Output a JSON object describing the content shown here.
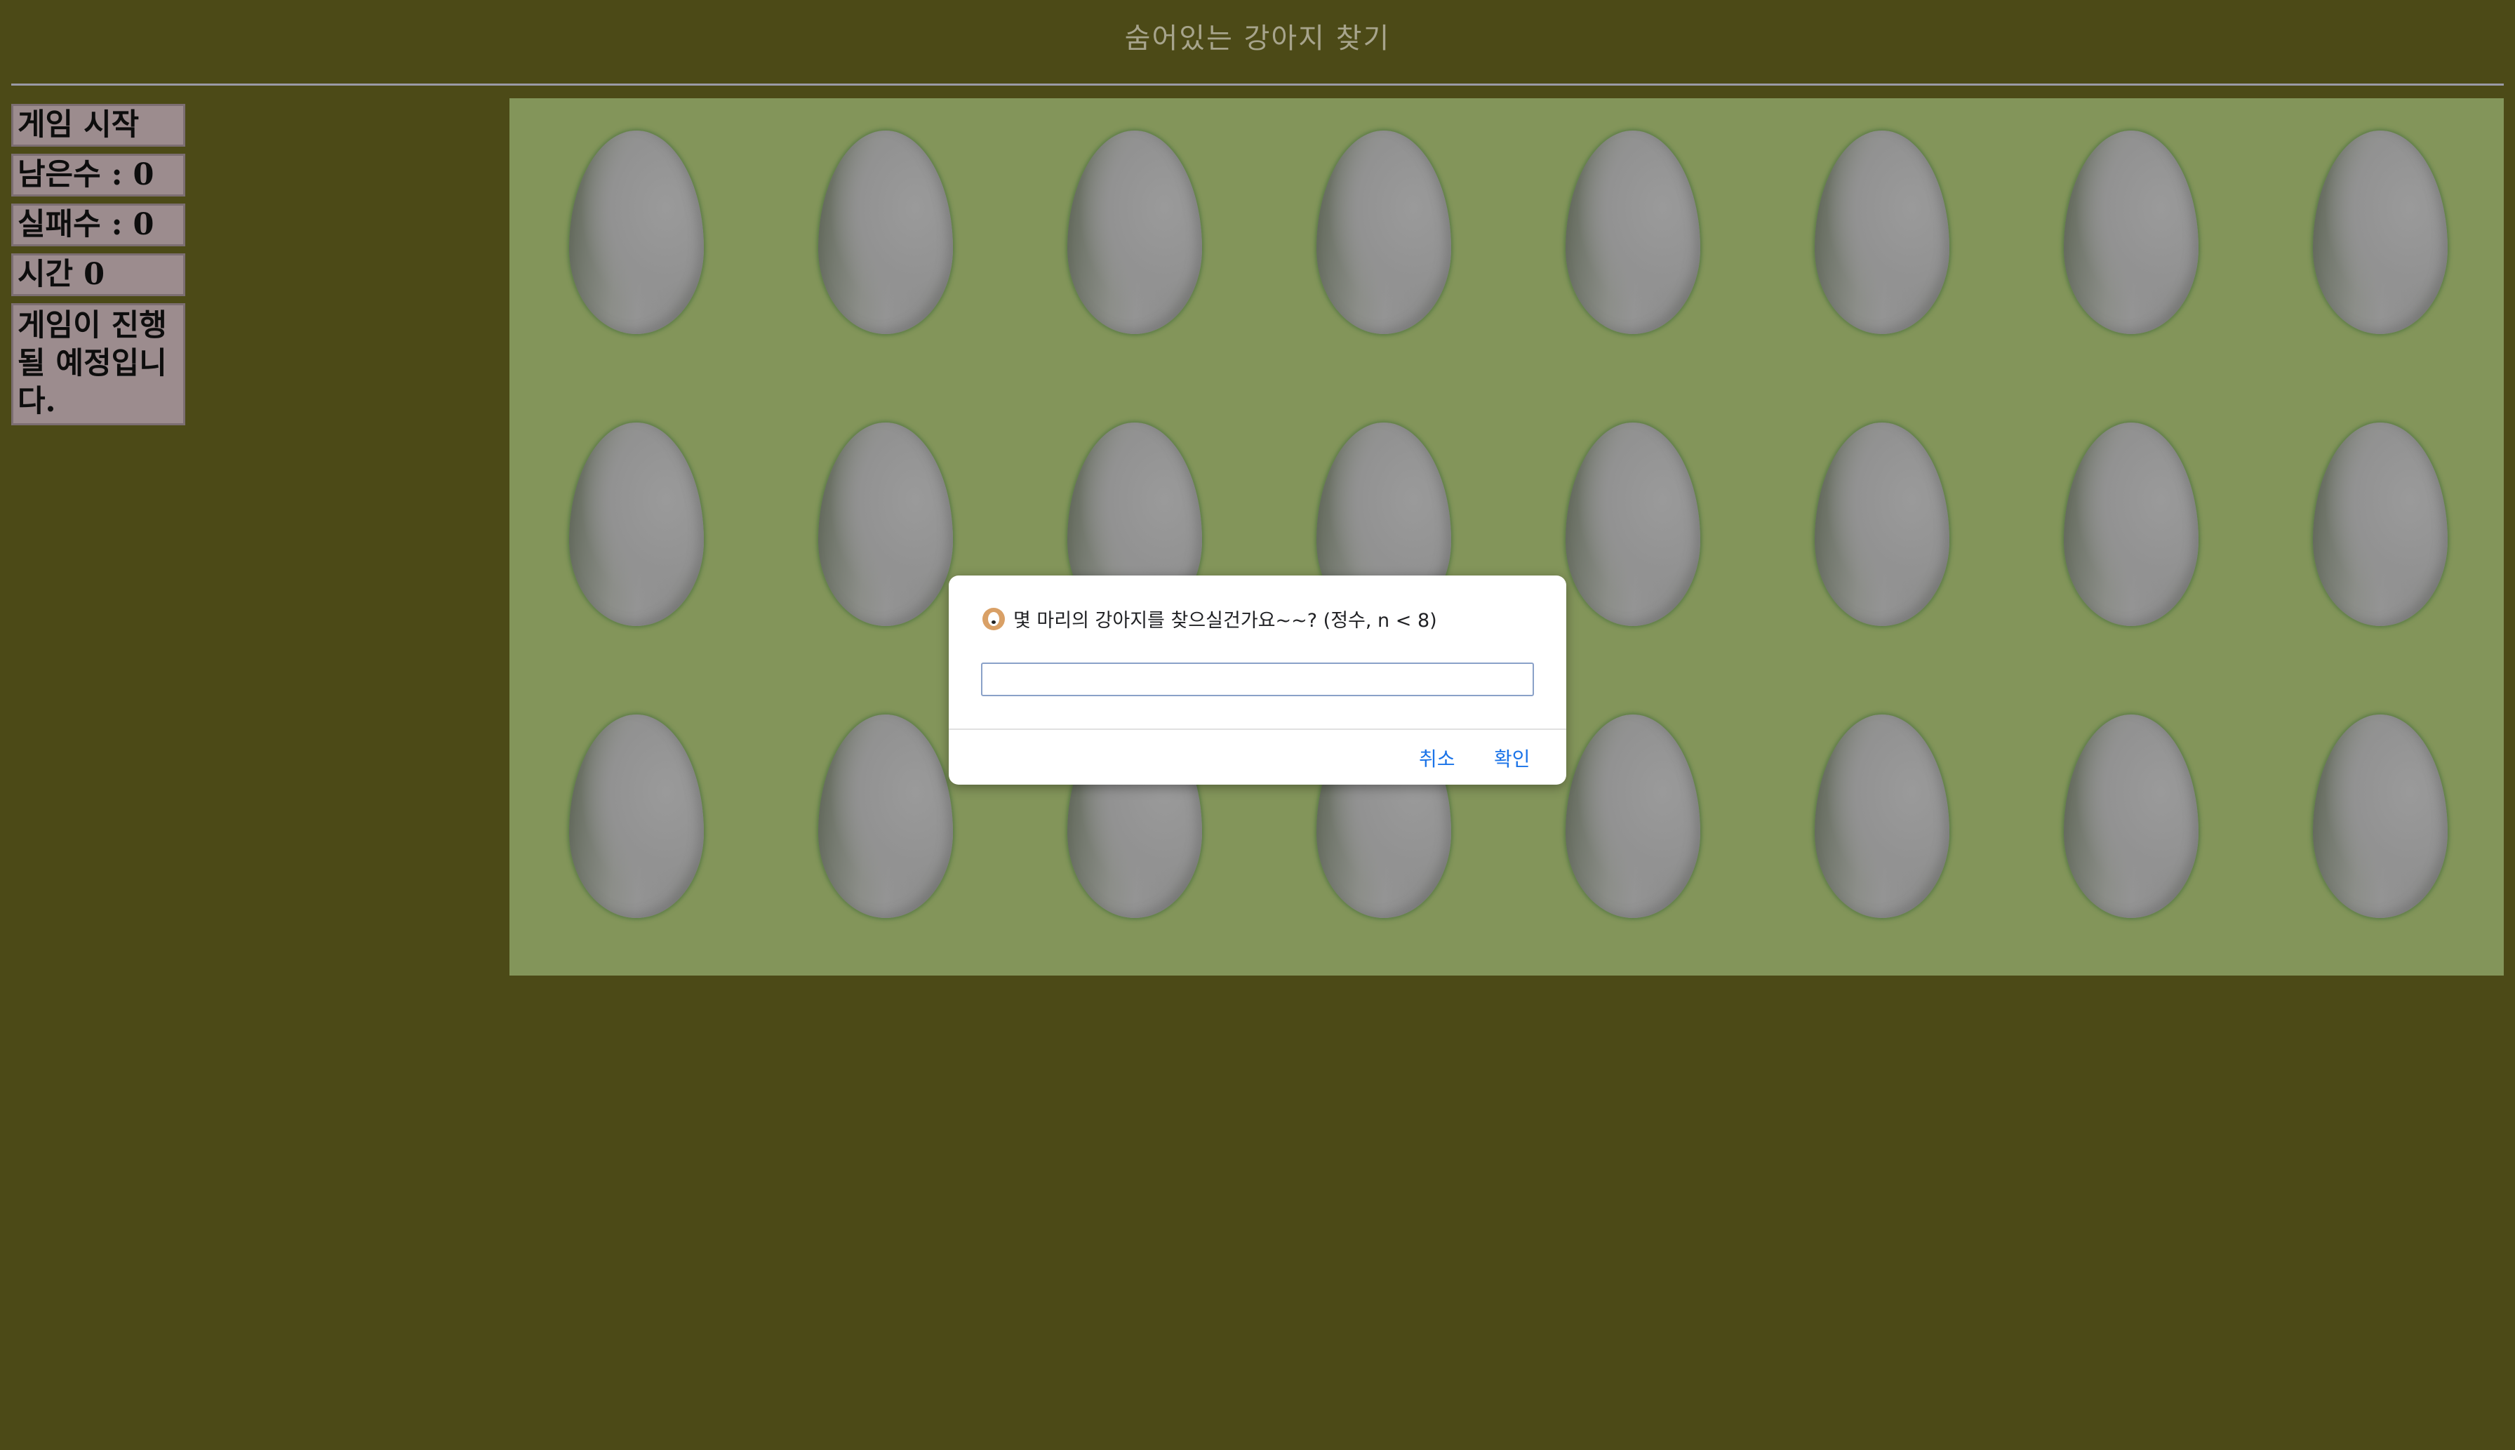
{
  "header": {
    "title": "숨어있는 강아지 찾기"
  },
  "sidebar": {
    "start_button": "게임 시작",
    "remaining": "남은수 : 0",
    "failures": "실패수 : 0",
    "time": "시간 0",
    "status": "게임이 진행될 예정입니다."
  },
  "board": {
    "rows": 3,
    "columns": 8,
    "cells": 24,
    "cell_icon": "egg-icon"
  },
  "dialog": {
    "icon": "dog-icon",
    "message": "몇 마리의 강아지를 찾으실건가요~~? (정수, n < 8)",
    "input_value": "",
    "cancel_label": "취소",
    "ok_label": "확인"
  },
  "colors": {
    "page_background": "#4c4a17",
    "board_background": "#83955a",
    "sidebar_box": "#9c8c8e",
    "title_text": "#a7a48c",
    "dialog_button": "#1a73e8"
  }
}
